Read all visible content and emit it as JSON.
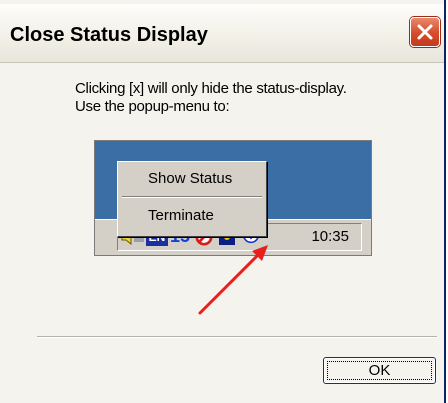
{
  "window": {
    "title": "Close Status Display"
  },
  "message": {
    "line1": "Clicking [x] will only hide the status-display.",
    "line2": "Use the popup-menu to:"
  },
  "illustration": {
    "menu": {
      "show_status_label": "Show Status",
      "terminate_label": "Terminate"
    },
    "tray": {
      "lang_badge": "EN",
      "number_badge": "15",
      "clock": "10:35"
    }
  },
  "buttons": {
    "ok_label": "OK"
  },
  "colors": {
    "desktop": "#3a6ea5",
    "arrow": "#e8201c",
    "close_button": "#d64b2a"
  }
}
